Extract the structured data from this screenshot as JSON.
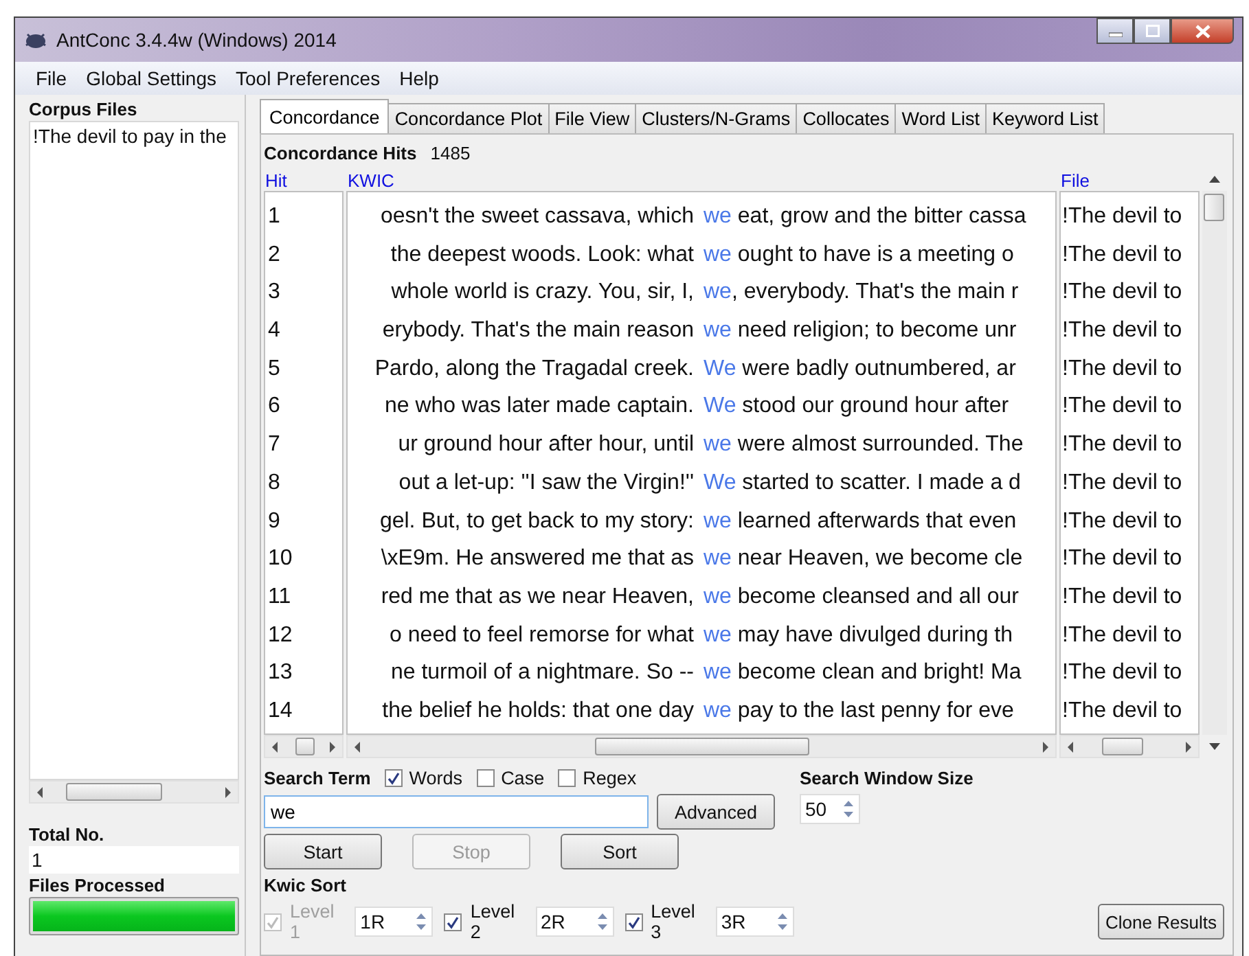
{
  "window": {
    "title": "AntConc 3.4.4w (Windows) 2014"
  },
  "menu": [
    "File",
    "Global Settings",
    "Tool Preferences",
    "Help"
  ],
  "corpus_files": {
    "label": "Corpus Files",
    "files": [
      "!The devil to pay in the"
    ]
  },
  "total": {
    "label": "Total No.",
    "value": "1"
  },
  "files_processed": {
    "label": "Files Processed",
    "level": 1
  },
  "tabs": [
    {
      "label": "Concordance",
      "selected": true
    },
    {
      "label": "Concordance Plot",
      "selected": false
    },
    {
      "label": "File View",
      "selected": false
    },
    {
      "label": "Clusters/N-Grams",
      "selected": false
    },
    {
      "label": "Collocates",
      "selected": false
    },
    {
      "label": "Word List",
      "selected": false
    },
    {
      "label": "Keyword List",
      "selected": false
    }
  ],
  "hits": {
    "label": "Concordance Hits",
    "count": "1485"
  },
  "columns": [
    "Hit",
    "KWIC",
    "File"
  ],
  "rows": [
    {
      "hit": "1",
      "left": "oesn't the sweet cassava, which",
      "keyword": "we",
      "right": " eat, grow and the bitter cassa",
      "file": "!The devil to"
    },
    {
      "hit": "2",
      "left": "the deepest woods. Look: what",
      "keyword": "we",
      "right": " ought to have is a meeting o",
      "file": "!The devil to"
    },
    {
      "hit": "3",
      "left": "whole world is crazy. You, sir, I,",
      "keyword": "we",
      "right": ", everybody. That's the main r",
      "file": "!The devil to"
    },
    {
      "hit": "4",
      "left": "erybody. That's the main reason",
      "keyword": "we",
      "right": " need religion; to become unr",
      "file": "!The devil to"
    },
    {
      "hit": "5",
      "left": "Pardo, along the Tragadal creek.",
      "keyword": "We",
      "right": " were badly outnumbered, ar",
      "file": "!The devil to"
    },
    {
      "hit": "6",
      "left": "ne who was later made captain.",
      "keyword": "We",
      "right": " stood our ground hour after",
      "file": "!The devil to"
    },
    {
      "hit": "7",
      "left": "ur ground hour after hour, until",
      "keyword": "we",
      "right": " were almost surrounded. The",
      "file": "!The devil to"
    },
    {
      "hit": "8",
      "left": "out a let-up: ''I saw the Virgin!''",
      "keyword": "We",
      "right": " started to scatter. I made a d",
      "file": "!The devil to"
    },
    {
      "hit": "9",
      "left": "gel. But, to get back to my story:",
      "keyword": "we",
      "right": " learned afterwards that even",
      "file": "!The devil to"
    },
    {
      "hit": "10",
      "left": "\\xE9m. He answered me that as",
      "keyword": "we",
      "right": " near Heaven, we become cle",
      "file": "!The devil to"
    },
    {
      "hit": "11",
      "left": "red me that as we near Heaven,",
      "keyword": "we",
      "right": " become cleansed and all our",
      "file": "!The devil to"
    },
    {
      "hit": "12",
      "left": "o need to feel remorse for what",
      "keyword": "we",
      "right": " may have divulged during th",
      "file": "!The devil to"
    },
    {
      "hit": "13",
      "left": "ne turmoil of a nightmare. So --",
      "keyword": "we",
      "right": " become clean and bright! Ma",
      "file": "!The devil to"
    },
    {
      "hit": "14",
      "left": "the belief he holds: that one day",
      "keyword": "we",
      "right": " pay to the last penny for eve",
      "file": "!The devil to"
    }
  ],
  "search": {
    "label": "Search Term",
    "options": [
      {
        "label": "Words",
        "checked": true
      },
      {
        "label": "Case",
        "checked": false
      },
      {
        "label": "Regex",
        "checked": false
      }
    ],
    "value": "we",
    "advanced": "Advanced"
  },
  "window_size": {
    "label": "Search Window Size",
    "value": "50"
  },
  "buttons": [
    {
      "label": "Start",
      "disabled": false
    },
    {
      "label": "Stop",
      "disabled": true
    },
    {
      "label": "Sort",
      "disabled": false
    }
  ],
  "kwic_sort": {
    "label": "Kwic Sort",
    "levels": [
      {
        "label": "Level 1",
        "checked": true,
        "disabled": true,
        "value": "1R"
      },
      {
        "label": "Level 2",
        "checked": true,
        "disabled": false,
        "value": "2R"
      },
      {
        "label": "Level 3",
        "checked": true,
        "disabled": false,
        "value": "3R"
      }
    ]
  },
  "clone": "Clone Results"
}
